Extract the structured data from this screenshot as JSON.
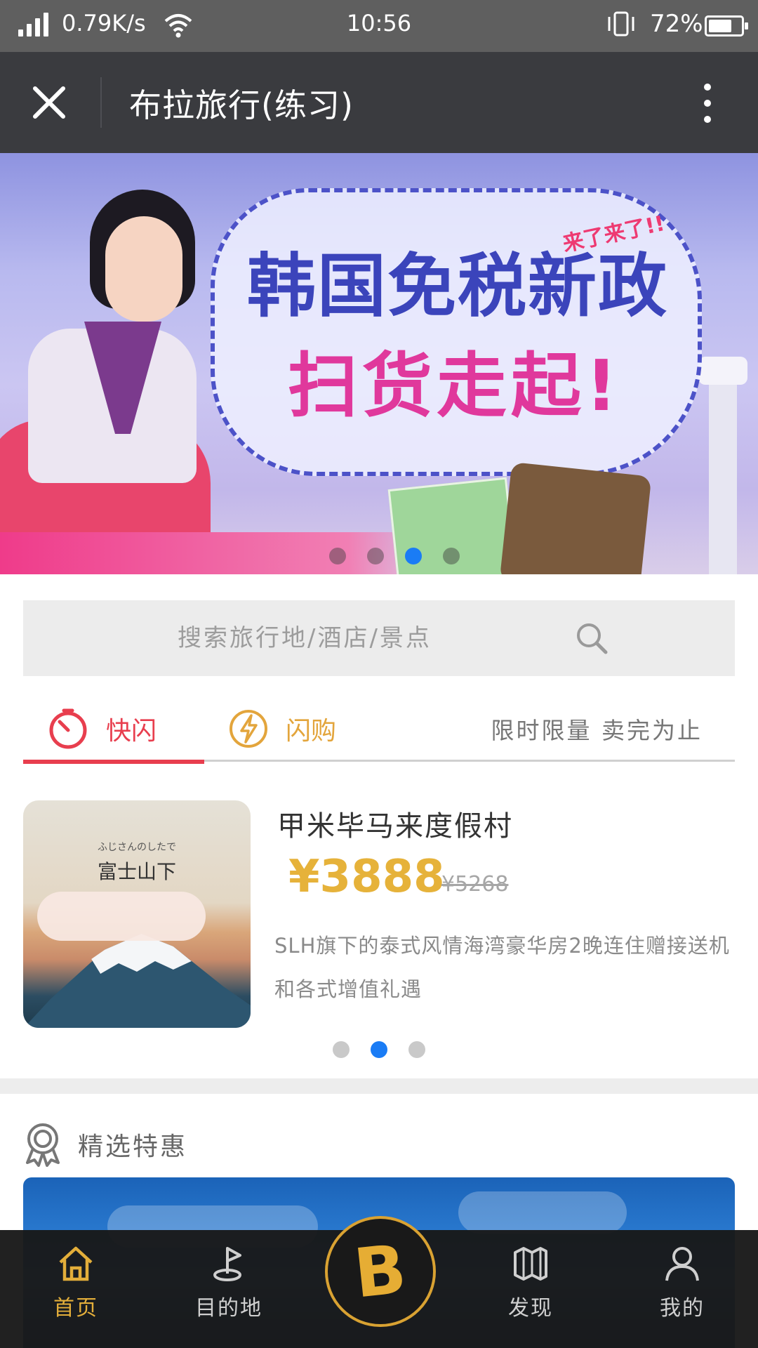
{
  "status_bar": {
    "speed": "0.79K/s",
    "time": "10:56",
    "battery": "72%",
    "battery_level": 0.72
  },
  "header": {
    "title": "布拉旅行(练习)"
  },
  "banner": {
    "line1": "韩国免税新政",
    "line2": "扫货走起!",
    "tag": "来了来了!!",
    "slide_count": 4,
    "active_slide": 3
  },
  "search": {
    "placeholder": "搜索旅行地/酒店/景点"
  },
  "flash_tabs": {
    "kuaishan": "快闪",
    "shangou": "闪购",
    "limit_text": "限时限量 卖完为止",
    "active": "kuaishan"
  },
  "deal": {
    "thumb_subtitle": "ふじさんのしたで",
    "thumb_title": "富士山下",
    "name": "甲米毕马来度假村",
    "price": "¥3888",
    "original_price": "¥5268",
    "description": "SLH旗下的泰式风情海湾豪华房2晚连住赠接送机和各式增值礼遇",
    "slide_count": 3,
    "active_slide": 2
  },
  "featured": {
    "label": "精选特惠"
  },
  "bottom_nav": {
    "home": "首页",
    "destination": "目的地",
    "center_logo": "B",
    "discover": "发现",
    "mine": "我的",
    "active": "home"
  },
  "colors": {
    "accent_red": "#e83e4e",
    "accent_gold": "#e3ae3a",
    "active_dot": "#1a7cf5",
    "title_bar": "#3a3b3f"
  }
}
